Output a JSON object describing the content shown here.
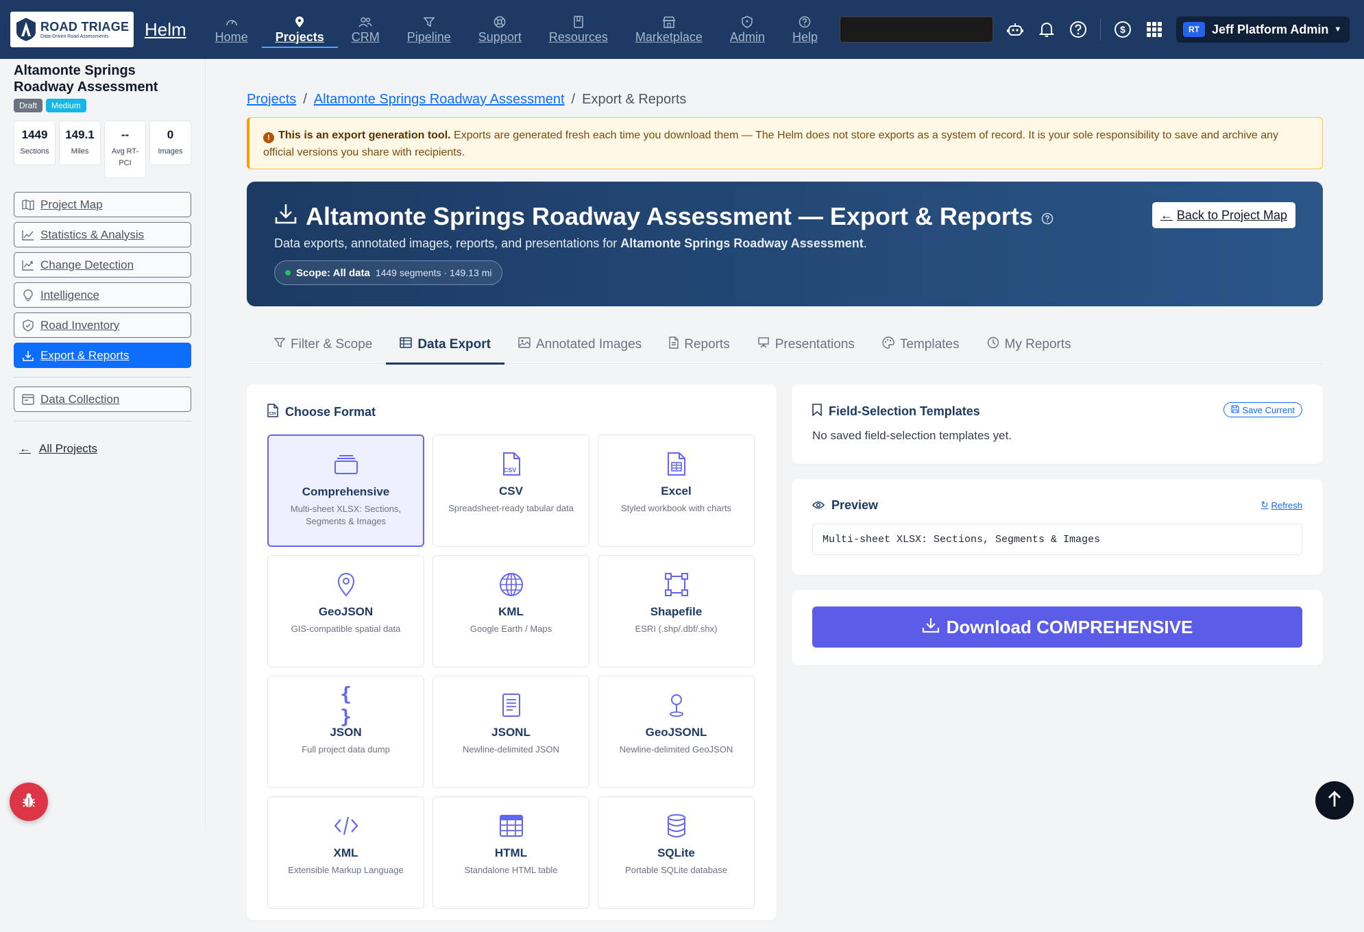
{
  "nav": {
    "logo_title": "ROAD TRIAGE",
    "logo_sub": "Data-Driven Road Assessments",
    "brand": "Helm",
    "items": [
      {
        "label": "Home",
        "icon": "gauge-icon"
      },
      {
        "label": "Projects",
        "icon": "location-pin-icon"
      },
      {
        "label": "CRM",
        "icon": "people-icon"
      },
      {
        "label": "Pipeline",
        "icon": "funnel-icon"
      },
      {
        "label": "Support",
        "icon": "lifebuoy-icon"
      },
      {
        "label": "Resources",
        "icon": "book-icon"
      },
      {
        "label": "Marketplace",
        "icon": "shop-icon"
      },
      {
        "label": "Admin",
        "icon": "shield-icon"
      },
      {
        "label": "Help",
        "icon": "question-icon"
      }
    ],
    "active": "Projects",
    "user_initials": "RT",
    "user_name": "Jeff Platform Admin"
  },
  "sidebar": {
    "project_title": "Altamonte Springs Roadway Assessment",
    "badges": [
      "Draft",
      "Medium"
    ],
    "stats": [
      {
        "value": "1449",
        "label": "Sections"
      },
      {
        "value": "149.1",
        "label": "Miles"
      },
      {
        "value": "--",
        "label": "Avg RT-PCI"
      },
      {
        "value": "0",
        "label": "Images"
      }
    ],
    "items": [
      {
        "label": "Project Map",
        "icon": "map-icon"
      },
      {
        "label": "Statistics & Analysis",
        "icon": "chart-icon"
      },
      {
        "label": "Change Detection",
        "icon": "trend-icon"
      },
      {
        "label": "Intelligence",
        "icon": "lightbulb-icon"
      },
      {
        "label": "Road Inventory",
        "icon": "shield-check-icon"
      },
      {
        "label": "Export & Reports",
        "icon": "download-icon"
      }
    ],
    "extra_item": {
      "label": "Data Collection",
      "icon": "card-icon"
    },
    "all_projects": "All Projects"
  },
  "breadcrumb": [
    "Projects",
    "Altamonte Springs Roadway Assessment",
    "Export & Reports"
  ],
  "warning": {
    "bold": "This is an export generation tool.",
    "text": " Exports are generated fresh each time you download them — The Helm does not store exports as a system of record. It is your sole responsibility to save and archive any official versions you share with recipients."
  },
  "hero": {
    "title": "Altamonte Springs Roadway Assessment — Export & Reports",
    "desc_prefix": "Data exports, annotated images, reports, and presentations for ",
    "desc_project": "Altamonte Springs Roadway Assessment",
    "desc_suffix": ".",
    "scope_label": "Scope: All data",
    "scope_detail": "1449 segments · 149.13 mi",
    "back_label": "Back to Project Map"
  },
  "tabs": [
    {
      "label": "Filter & Scope",
      "icon": "funnel-icon"
    },
    {
      "label": "Data Export",
      "icon": "table-icon"
    },
    {
      "label": "Annotated Images",
      "icon": "image-icon"
    },
    {
      "label": "Reports",
      "icon": "document-icon"
    },
    {
      "label": "Presentations",
      "icon": "easel-icon"
    },
    {
      "label": "Templates",
      "icon": "palette-icon"
    },
    {
      "label": "My Reports",
      "icon": "clock-icon"
    }
  ],
  "active_tab": "Data Export",
  "formats": {
    "heading": "Choose Format",
    "items": [
      {
        "name": "Comprehensive",
        "desc": "Multi-sheet XLSX: Sections, Segments & Images",
        "icon": "layers-icon"
      },
      {
        "name": "CSV",
        "desc": "Spreadsheet-ready tabular data",
        "icon": "csv-file-icon"
      },
      {
        "name": "Excel",
        "desc": "Styled workbook with charts",
        "icon": "spreadsheet-file-icon"
      },
      {
        "name": "GeoJSON",
        "desc": "GIS-compatible spatial data",
        "icon": "geo-pin-icon"
      },
      {
        "name": "KML",
        "desc": "Google Earth / Maps",
        "icon": "globe-icon"
      },
      {
        "name": "Shapefile",
        "desc": "ESRI (.shp/.dbf/.shx)",
        "icon": "bounding-box-icon"
      },
      {
        "name": "JSON",
        "desc": "Full project data dump",
        "icon": "braces-icon"
      },
      {
        "name": "JSONL",
        "desc": "Newline-delimited JSON",
        "icon": "text-file-icon"
      },
      {
        "name": "GeoJSONL",
        "desc": "Newline-delimited GeoJSON",
        "icon": "pushpin-icon"
      },
      {
        "name": "XML",
        "desc": "Extensible Markup Language",
        "icon": "code-icon"
      },
      {
        "name": "HTML",
        "desc": "Standalone HTML table",
        "icon": "grid-table-icon"
      },
      {
        "name": "SQLite",
        "desc": "Portable SQLite database",
        "icon": "database-icon"
      }
    ],
    "selected": "Comprehensive"
  },
  "templates": {
    "heading": "Field-Selection Templates",
    "save_label": "Save Current",
    "empty": "No saved field-selection templates yet."
  },
  "preview": {
    "heading": "Preview",
    "refresh": "Refresh",
    "text": "Multi-sheet XLSX: Sections, Segments & Images"
  },
  "download": {
    "label": "Download COMPREHENSIVE"
  },
  "colors": {
    "navy": "#1c3a63",
    "accent": "#6366f1",
    "primary": "#0d6efd",
    "download": "#5b5ce8"
  }
}
